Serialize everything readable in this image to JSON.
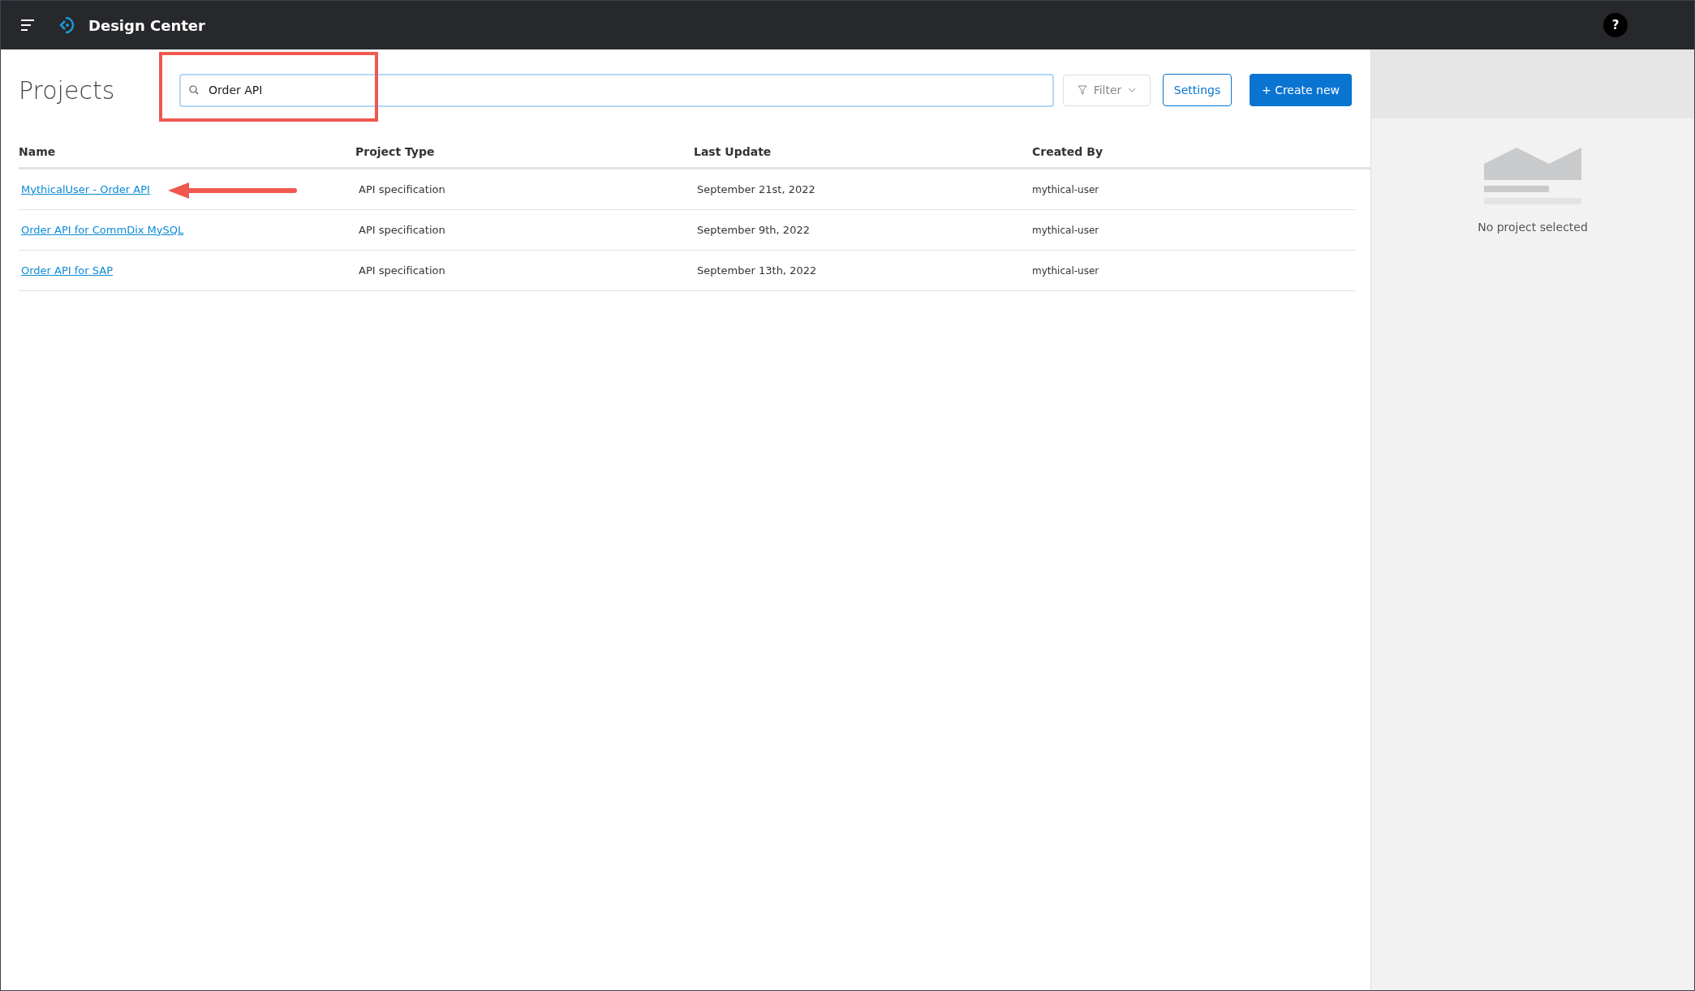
{
  "app_bar": {
    "title": "Design Center",
    "help": "?"
  },
  "page": {
    "title": "Projects"
  },
  "search": {
    "value": "Order API"
  },
  "toolbar": {
    "filter": "Filter",
    "settings": "Settings",
    "create": "+ Create new"
  },
  "table": {
    "columns": [
      "Name",
      "Project Type",
      "Last Update",
      "Created By"
    ],
    "rows": [
      {
        "name": "MythicalUser - Order API",
        "type": "API specification",
        "updated": "September 21st, 2022",
        "created_by": "mythical-user"
      },
      {
        "name": "Order API for CommDix MySQL",
        "type": "API specification",
        "updated": "September 9th, 2022",
        "created_by": "mythical-user"
      },
      {
        "name": "Order API for SAP",
        "type": "API specification",
        "updated": "September 13th, 2022",
        "created_by": "mythical-user"
      }
    ]
  },
  "detail_panel": {
    "empty_text": "No project selected"
  }
}
